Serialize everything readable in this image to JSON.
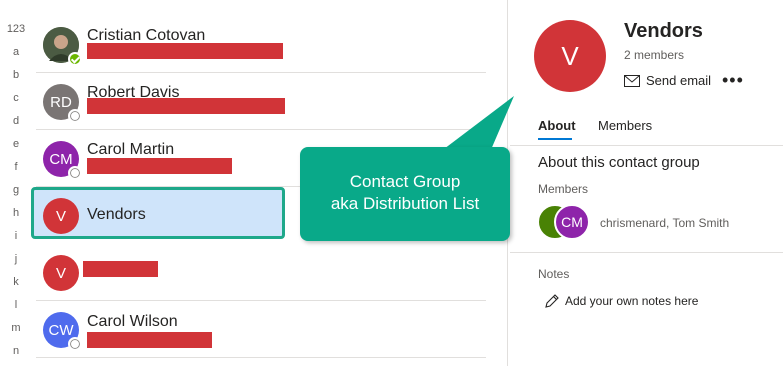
{
  "alphabet": [
    "123",
    "a",
    "b",
    "c",
    "d",
    "e",
    "f",
    "g",
    "h",
    "i",
    "j",
    "k",
    "l",
    "m",
    "n"
  ],
  "contacts": [
    {
      "name": "Cristian Cotovan",
      "initials": "",
      "color": "#5b6b4e",
      "presence": "available"
    },
    {
      "name": "Robert Davis",
      "initials": "RD",
      "color": "#7a7574",
      "presence": "offline"
    },
    {
      "name": "Carol Martin",
      "initials": "CM",
      "color": "#8e24aa",
      "presence": "offline"
    },
    {
      "name": "Vendors",
      "initials": "V",
      "color": "#d13438",
      "presence": ""
    },
    {
      "name": "",
      "initials": "V",
      "color": "#d13438",
      "presence": ""
    },
    {
      "name": "Carol Wilson",
      "initials": "CW",
      "color": "#4f6bed",
      "presence": "offline"
    }
  ],
  "callout": {
    "line1": "Contact Group",
    "line2": "aka Distribution List"
  },
  "detail": {
    "avatar": "V",
    "title": "Vendors",
    "subtitle": "2 members",
    "send_email": "Send email",
    "more": "•••",
    "tabs": [
      "About",
      "Members"
    ],
    "section_title": "About this contact group",
    "members_label": "Members",
    "member_avatar": "CM",
    "members_text": "chrismenard, Tom Smith",
    "notes_label": "Notes",
    "notes_add": "Add your own notes here"
  },
  "colors": {
    "accent": "#0078d4",
    "callout": "#09a989",
    "selection": "#cfe4fa",
    "redaction": "#d13438"
  }
}
